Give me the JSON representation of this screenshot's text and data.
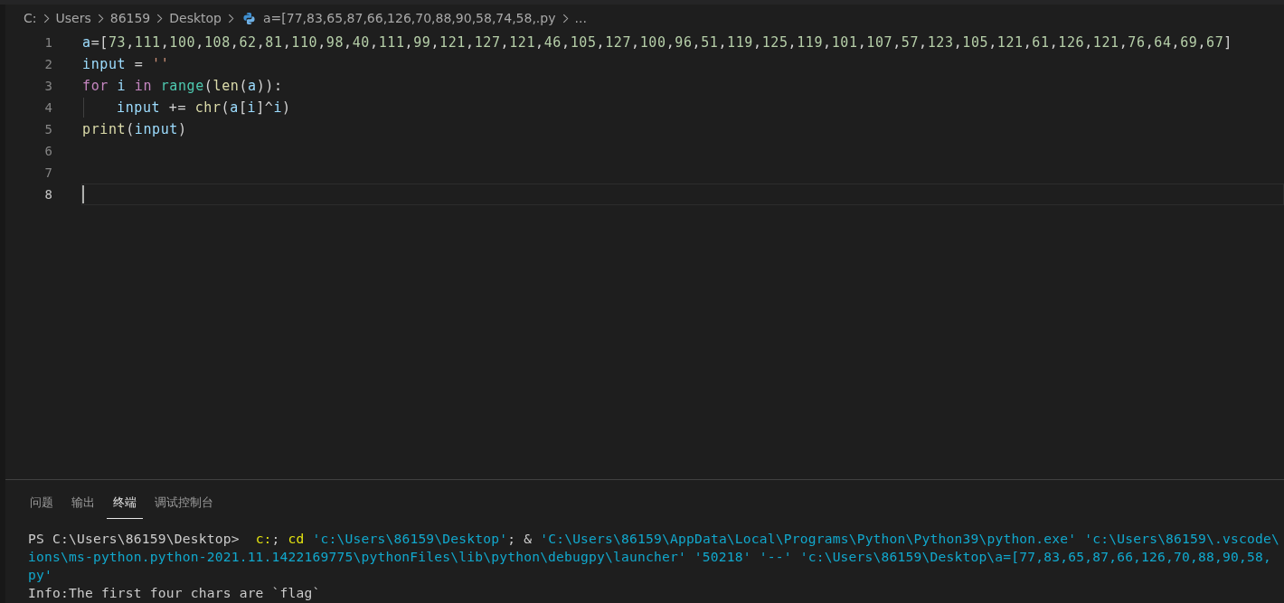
{
  "breadcrumbs": [
    {
      "text": "C:",
      "kind": "folder"
    },
    {
      "text": "Users",
      "kind": "folder"
    },
    {
      "text": "86159",
      "kind": "folder"
    },
    {
      "text": "Desktop",
      "kind": "folder"
    },
    {
      "text": "a=[77,83,65,87,66,126,70,88,90,58,74,58,.py",
      "kind": "file"
    },
    {
      "text": "...",
      "kind": "more"
    }
  ],
  "editor": {
    "lines": [
      {
        "number": "1",
        "active": false,
        "indent": false,
        "tokens": [
          {
            "text": "a",
            "kind": "var"
          },
          {
            "text": "=[",
            "kind": "plain"
          },
          {
            "text": "73,111,100,108,62,81,110,98,40,111,99,121,127,121,46,105,127,100,96,51,119,125,119,101,107,57,123,105,121,61,126,121,76,64,69,67",
            "kind": "numlist"
          },
          {
            "text": "]",
            "kind": "plain"
          }
        ]
      },
      {
        "number": "2",
        "active": false,
        "indent": false,
        "tokens": [
          {
            "text": "input",
            "kind": "var"
          },
          {
            "text": " = ",
            "kind": "plain"
          },
          {
            "text": "''",
            "kind": "string"
          }
        ]
      },
      {
        "number": "3",
        "active": false,
        "indent": false,
        "tokens": [
          {
            "text": "for ",
            "kind": "keyword"
          },
          {
            "text": "i ",
            "kind": "var"
          },
          {
            "text": "in ",
            "kind": "keyword"
          },
          {
            "text": "range",
            "kind": "class"
          },
          {
            "text": "(",
            "kind": "plain"
          },
          {
            "text": "len",
            "kind": "func"
          },
          {
            "text": "(",
            "kind": "plain"
          },
          {
            "text": "a",
            "kind": "var"
          },
          {
            "text": ")):",
            "kind": "plain"
          }
        ]
      },
      {
        "number": "4",
        "active": false,
        "indent": true,
        "tokens": [
          {
            "text": "input",
            "kind": "var"
          },
          {
            "text": " += ",
            "kind": "plain"
          },
          {
            "text": "chr",
            "kind": "func"
          },
          {
            "text": "(",
            "kind": "plain"
          },
          {
            "text": "a",
            "kind": "var"
          },
          {
            "text": "[",
            "kind": "plain"
          },
          {
            "text": "i",
            "kind": "var"
          },
          {
            "text": "]^",
            "kind": "plain"
          },
          {
            "text": "i",
            "kind": "var"
          },
          {
            "text": ")",
            "kind": "plain"
          }
        ]
      },
      {
        "number": "5",
        "active": false,
        "indent": false,
        "tokens": [
          {
            "text": "print",
            "kind": "func"
          },
          {
            "text": "(",
            "kind": "plain"
          },
          {
            "text": "input",
            "kind": "var"
          },
          {
            "text": ")",
            "kind": "plain"
          }
        ]
      },
      {
        "number": "6",
        "active": false,
        "indent": false
      },
      {
        "number": "7",
        "active": false,
        "indent": false
      },
      {
        "number": "8",
        "active": true,
        "indent": false
      }
    ]
  },
  "panel": {
    "tabs": [
      {
        "label": "问题",
        "selected": false
      },
      {
        "label": "输出",
        "selected": false
      },
      {
        "label": "终端",
        "selected": true
      },
      {
        "label": "调试控制台",
        "selected": false
      }
    ],
    "terminal_lines": [
      [
        {
          "text": "PS C:\\Users\\86159\\Desktop>  ",
          "kind": "plain"
        },
        {
          "text": "c:",
          "kind": "command"
        },
        {
          "text": "; ",
          "kind": "plain"
        },
        {
          "text": "cd",
          "kind": "command"
        },
        {
          "text": " 'c:\\Users\\86159\\Desktop'",
          "kind": "string"
        },
        {
          "text": "; & ",
          "kind": "plain"
        },
        {
          "text": "'C:\\Users\\86159\\AppData\\Local\\Programs\\Python\\Python39\\python.exe' 'c:\\Users\\86159\\.vscode\\",
          "kind": "string"
        }
      ],
      [
        {
          "text": "ions\\ms-python.python-2021.11.1422169775\\pythonFiles\\lib\\python\\debugpy\\launcher' '50218' '--' 'c:\\Users\\86159\\Desktop\\a=[77,83,65,87,66,126,70,88,90,58,",
          "kind": "string"
        }
      ],
      [
        {
          "text": "py'",
          "kind": "string"
        }
      ],
      [
        {
          "text": "Info:The first four chars are `flag`",
          "kind": "plain"
        }
      ]
    ]
  }
}
